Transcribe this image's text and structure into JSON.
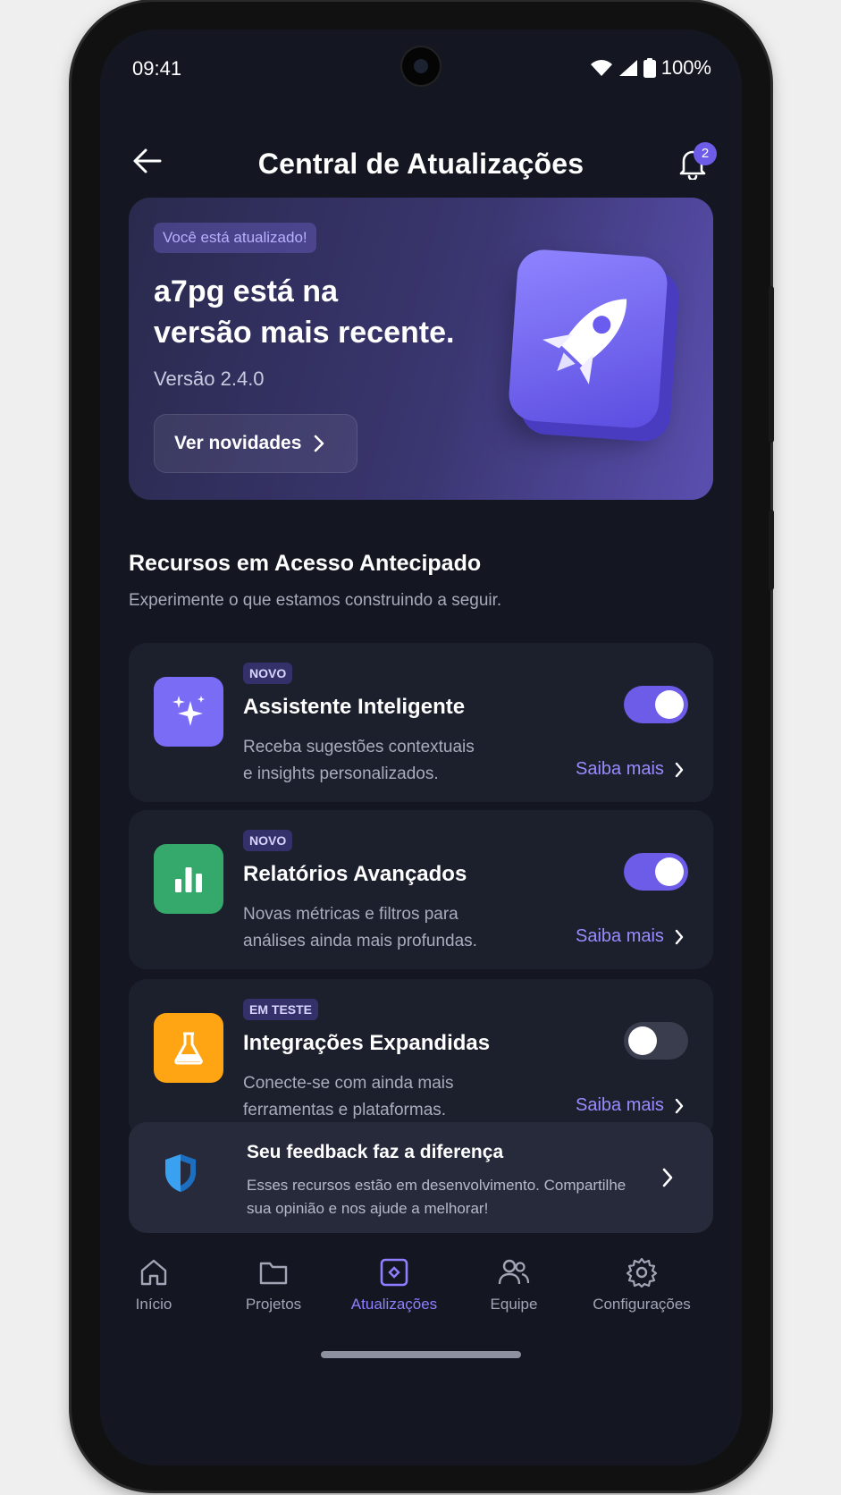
{
  "status": {
    "time": "09:41",
    "battery": "100%"
  },
  "header": {
    "title": "Central de Atualizações",
    "notification_count": "2"
  },
  "hero": {
    "pill": "Você está atualizado!",
    "headline_line1": "a7pg está na",
    "headline_line2": "versão mais recente.",
    "version": "Versão 2.4.0",
    "cta": "Ver novidades"
  },
  "section": {
    "title": "Recursos em Acesso Antecipado",
    "subtitle": "Experimente o que estamos construindo a seguir."
  },
  "features": [
    {
      "tag": "NOVO",
      "name": "Assistente Inteligente",
      "desc_line1": "Receba sugestões contextuais",
      "desc_line2": "e insights personalizados.",
      "enabled": true,
      "more": "Saiba mais",
      "icon": "sparkles-icon",
      "color": "#7b6cf6"
    },
    {
      "tag": "NOVO",
      "name": "Relatórios Avançados",
      "desc_line1": "Novas métricas e filtros para",
      "desc_line2": "análises ainda mais profundas.",
      "enabled": true,
      "more": "Saiba mais",
      "icon": "bar-chart-icon",
      "color": "#35a86b"
    },
    {
      "tag": "EM TESTE",
      "name": "Integrações Expandidas",
      "desc_line1": "Conecte-se com ainda mais",
      "desc_line2": "ferramentas e plataformas.",
      "enabled": false,
      "more": "Saiba mais",
      "icon": "flask-icon",
      "color": "#ffa413"
    }
  ],
  "feedback": {
    "title": "Seu feedback faz a diferença",
    "desc_line1": "Esses recursos estão em desenvolvimento. Compartilhe",
    "desc_line2": "sua opinião e nos ajude a melhorar!"
  },
  "nav": {
    "items": [
      {
        "label": "Início",
        "icon": "home-icon"
      },
      {
        "label": "Projetos",
        "icon": "folder-icon"
      },
      {
        "label": "Atualizações",
        "icon": "update-tag-icon",
        "active": true
      },
      {
        "label": "Equipe",
        "icon": "team-icon"
      },
      {
        "label": "Configurações",
        "icon": "settings-icon"
      }
    ]
  },
  "colors": {
    "accent": "#6c5ce7",
    "background": "#141722",
    "card": "#1c1f2c"
  }
}
